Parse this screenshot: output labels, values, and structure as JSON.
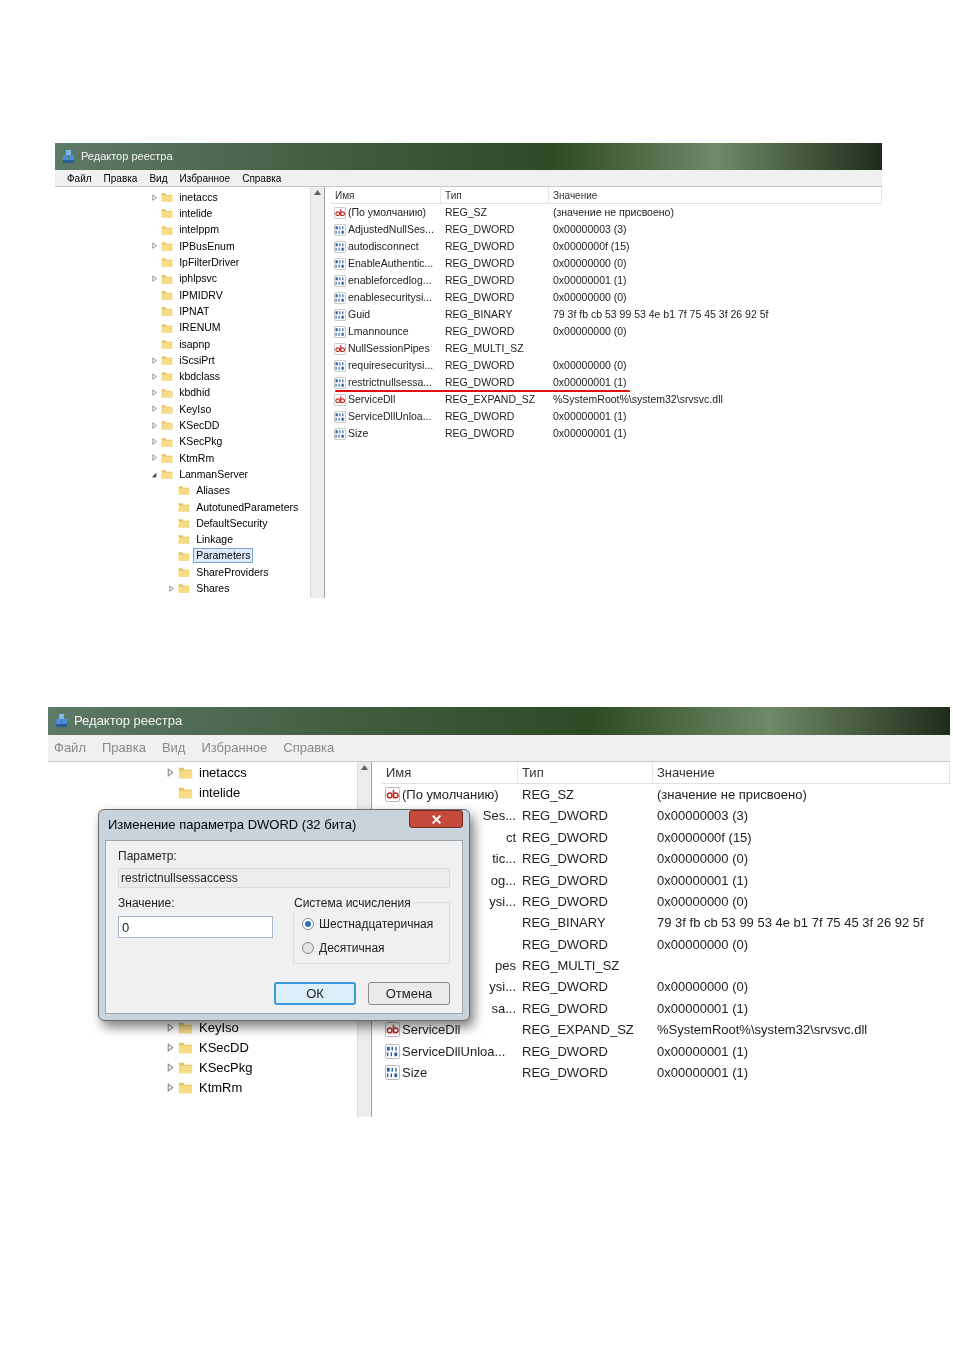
{
  "shots": [
    {
      "title": "Редактор реестра",
      "menu": [
        "Файл",
        "Правка",
        "Вид",
        "Избранное",
        "Справка"
      ],
      "tree_top": [
        {
          "label": "inetaccs",
          "expandable": true,
          "expanded": false,
          "selected": false
        },
        {
          "label": "intelide",
          "expandable": false,
          "selected": false
        },
        {
          "label": "intelppm",
          "expandable": false,
          "selected": false
        },
        {
          "label": "IPBusEnum",
          "expandable": true,
          "expanded": false,
          "selected": false
        },
        {
          "label": "IpFilterDriver",
          "expandable": false,
          "selected": false
        },
        {
          "label": "iphlpsvc",
          "expandable": true,
          "expanded": false,
          "selected": false
        },
        {
          "label": "IPMIDRV",
          "expandable": false,
          "selected": false
        },
        {
          "label": "IPNAT",
          "expandable": false,
          "selected": false
        },
        {
          "label": "IRENUM",
          "expandable": false,
          "selected": false
        },
        {
          "label": "isapnp",
          "expandable": false,
          "selected": false
        },
        {
          "label": "iScsiPrt",
          "expandable": true,
          "expanded": false,
          "selected": false
        },
        {
          "label": "kbdclass",
          "expandable": true,
          "expanded": false,
          "selected": false
        },
        {
          "label": "kbdhid",
          "expandable": true,
          "expanded": false,
          "selected": false
        },
        {
          "label": "KeyIso",
          "expandable": true,
          "expanded": false,
          "selected": false
        },
        {
          "label": "KSecDD",
          "expandable": true,
          "expanded": false,
          "selected": false
        },
        {
          "label": "KSecPkg",
          "expandable": true,
          "expanded": false,
          "selected": false
        },
        {
          "label": "KtmRm",
          "expandable": true,
          "expanded": false,
          "selected": false
        },
        {
          "label": "LanmanServer",
          "expandable": true,
          "expanded": true,
          "selected": false,
          "children": [
            {
              "label": "Aliases",
              "expandable": false,
              "selected": false
            },
            {
              "label": "AutotunedParameters",
              "expandable": false,
              "selected": false
            },
            {
              "label": "DefaultSecurity",
              "expandable": false,
              "selected": false
            },
            {
              "label": "Linkage",
              "expandable": false,
              "selected": false
            },
            {
              "label": "Parameters",
              "expandable": false,
              "selected": true
            },
            {
              "label": "ShareProviders",
              "expandable": false,
              "selected": false
            },
            {
              "label": "Shares",
              "expandable": true,
              "expanded": false,
              "selected": false
            }
          ]
        }
      ],
      "columns": [
        "Имя",
        "Тип",
        "Значение"
      ],
      "rows": [
        {
          "kind": "string",
          "name": "(По умолчанию)",
          "type": "REG_SZ",
          "value": "(значение не присвоено)",
          "highlighted": false
        },
        {
          "kind": "binary",
          "name": "AdjustedNullSes...",
          "type": "REG_DWORD",
          "value": "0x00000003 (3)",
          "highlighted": false
        },
        {
          "kind": "binary",
          "name": "autodisconnect",
          "type": "REG_DWORD",
          "value": "0x0000000f (15)",
          "highlighted": false
        },
        {
          "kind": "binary",
          "name": "EnableAuthentic...",
          "type": "REG_DWORD",
          "value": "0x00000000 (0)",
          "highlighted": false
        },
        {
          "kind": "binary",
          "name": "enableforcedlog...",
          "type": "REG_DWORD",
          "value": "0x00000001 (1)",
          "highlighted": false
        },
        {
          "kind": "binary",
          "name": "enablesecuritysi...",
          "type": "REG_DWORD",
          "value": "0x00000000 (0)",
          "highlighted": false
        },
        {
          "kind": "binary",
          "name": "Guid",
          "type": "REG_BINARY",
          "value": "79 3f fb cb 53 99 53 4e b1 7f 75 45 3f 26 92 5f",
          "highlighted": false
        },
        {
          "kind": "binary",
          "name": "Lmannounce",
          "type": "REG_DWORD",
          "value": "0x00000000 (0)",
          "highlighted": false
        },
        {
          "kind": "string",
          "name": "NullSessionPipes",
          "type": "REG_MULTI_SZ",
          "highlighted": false
        },
        {
          "kind": "binary",
          "name": "requiresecuritysi...",
          "type": "REG_DWORD",
          "value": "0x00000000 (0)",
          "highlighted": false
        },
        {
          "kind": "binary",
          "name": "restrictnullsessa...",
          "type": "REG_DWORD",
          "value": "0x00000001 (1)",
          "highlighted": true
        },
        {
          "kind": "string",
          "name": "ServiceDll",
          "type": "REG_EXPAND_SZ",
          "value": "%SystemRoot%\\system32\\srvsvc.dll",
          "highlighted": false
        },
        {
          "kind": "binary",
          "name": "ServiceDllUnloa...",
          "type": "REG_DWORD",
          "value": "0x00000001 (1)",
          "highlighted": false
        },
        {
          "kind": "binary",
          "name": "Size",
          "type": "REG_DWORD",
          "value": "0x00000001 (1)",
          "highlighted": false
        }
      ]
    },
    {
      "title": "Редактор реестра",
      "menu": [
        "Файл",
        "Правка",
        "Вид",
        "Избранное",
        "Справка"
      ],
      "tree_top": [
        {
          "label": "inetaccs",
          "expandable": true,
          "expanded": false,
          "selected": false
        },
        {
          "label": "intelide",
          "expandable": false,
          "selected": false
        }
      ],
      "tree_bottom": [
        {
          "label": "KeyIso",
          "expandable": true,
          "expanded": false,
          "selected": false
        },
        {
          "label": "KSecDD",
          "expandable": true,
          "expanded": false,
          "selected": false
        },
        {
          "label": "KSecPkg",
          "expandable": true,
          "expanded": false,
          "selected": false
        },
        {
          "label": "KtmRm",
          "expandable": true,
          "expanded": false,
          "selected": false
        }
      ],
      "columns": [
        "Имя",
        "Тип",
        "Значение"
      ],
      "rows": [
        {
          "kind": "string",
          "name": "(По умолчанию)",
          "type": "REG_SZ",
          "value": "(значение не присвоено)",
          "covered": false
        },
        {
          "name": "Ses...",
          "type": "REG_DWORD",
          "value": "0x00000003 (3)",
          "covered": true
        },
        {
          "name": "ct",
          "type": "REG_DWORD",
          "value": "0x0000000f (15)",
          "covered": true
        },
        {
          "name": "tic...",
          "type": "REG_DWORD",
          "value": "0x00000000 (0)",
          "covered": true
        },
        {
          "name": "og...",
          "type": "REG_DWORD",
          "value": "0x00000001 (1)",
          "covered": true
        },
        {
          "name": "ysi...",
          "type": "REG_DWORD",
          "value": "0x00000000 (0)",
          "covered": true
        },
        {
          "type": "REG_BINARY",
          "value": "79 3f fb cb 53 99 53 4e b1 7f 75 45 3f 26 92 5f"
        },
        {
          "type": "REG_DWORD",
          "value": "0x00000000 (0)"
        },
        {
          "name": "pes",
          "type": "REG_MULTI_SZ",
          "covered": true
        },
        {
          "name": "ysi...",
          "type": "REG_DWORD",
          "value": "0x00000000 (0)",
          "covered": true
        },
        {
          "name": "sa...",
          "type": "REG_DWORD",
          "value": "0x00000001 (1)",
          "covered": true
        },
        {
          "kind": "string",
          "name": "ServiceDll",
          "type": "REG_EXPAND_SZ",
          "value": "%SystemRoot%\\system32\\srvsvc.dll",
          "covered": false
        },
        {
          "kind": "binary",
          "name": "ServiceDllUnloa...",
          "type": "REG_DWORD",
          "value": "0x00000001 (1)",
          "covered": false
        },
        {
          "kind": "binary",
          "name": "Size",
          "type": "REG_DWORD",
          "value": "0x00000001 (1)",
          "covered": false
        }
      ],
      "dialog": {
        "title": "Изменение параметра DWORD (32 бита)",
        "name_label": "Параметр:",
        "name_value": "restrictnullsessaccess",
        "value_label": "Значение:",
        "value": "0",
        "base_label": "Система исчисления",
        "bases": [
          {
            "label": "Шестнадцатеричная",
            "selected": true
          },
          {
            "label": "Десятичная",
            "selected": false
          }
        ],
        "buttons": [
          {
            "label": "ОК",
            "kind": "default"
          },
          {
            "label": "Отмена",
            "kind": "normal"
          }
        ]
      }
    }
  ]
}
